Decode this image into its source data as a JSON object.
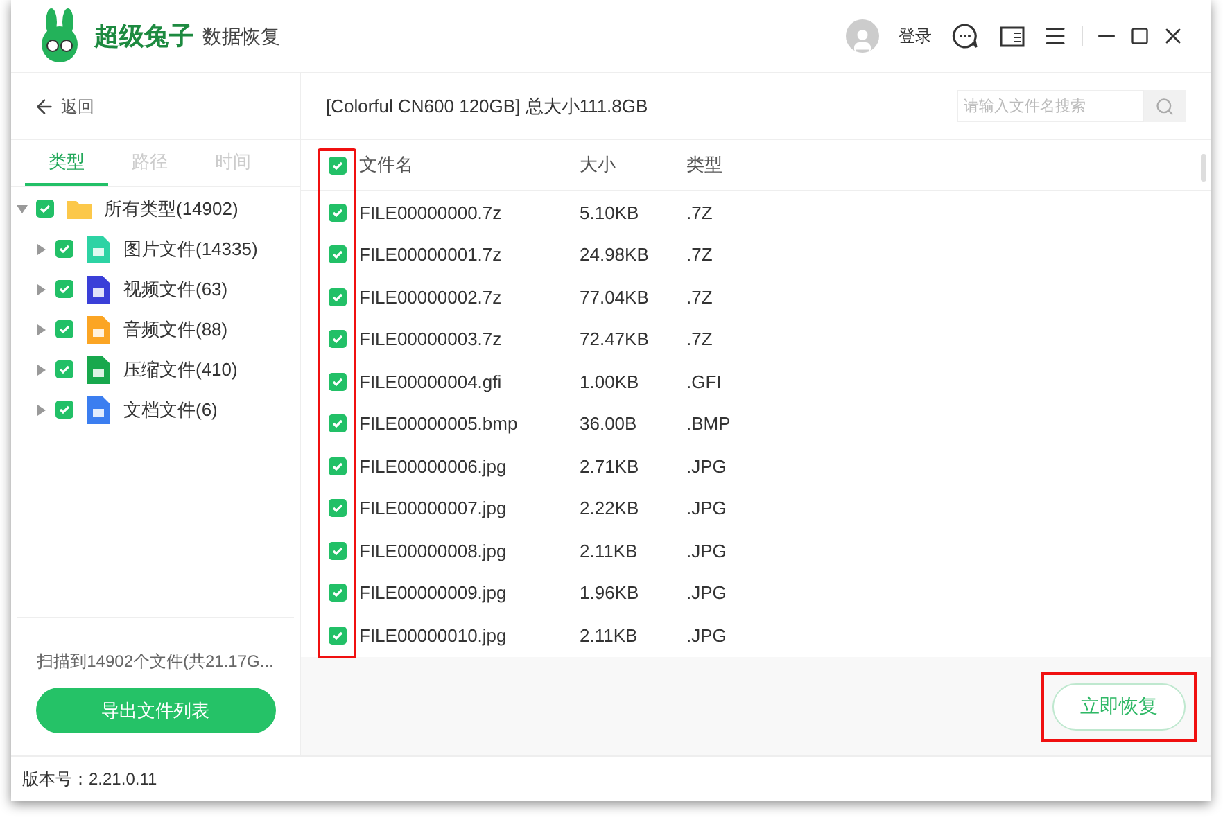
{
  "app": {
    "brand": "超级兔子",
    "product": "数据恢复"
  },
  "header": {
    "login": "登录"
  },
  "sidebar": {
    "back": "返回",
    "tabs": [
      {
        "label": "类型",
        "selected": true
      },
      {
        "label": "路径",
        "selected": false
      },
      {
        "label": "时间",
        "selected": false
      }
    ],
    "tree": [
      {
        "label": "所有类型(14902)",
        "kind": "folder",
        "checked": true,
        "expanded": true,
        "children": [
          {
            "label": "图片文件(14335)",
            "kind": "image",
            "checked": true,
            "expanded": false
          },
          {
            "label": "视频文件(63)",
            "kind": "video",
            "checked": true,
            "expanded": false
          },
          {
            "label": "音频文件(88)",
            "kind": "audio",
            "checked": true,
            "expanded": false
          },
          {
            "label": "压缩文件(410)",
            "kind": "archive",
            "checked": true,
            "expanded": false
          },
          {
            "label": "文档文件(6)",
            "kind": "document",
            "checked": true,
            "expanded": false
          }
        ]
      }
    ],
    "summary": "扫描到14902个文件(共21.17G...",
    "export_button": "导出文件列表"
  },
  "drive_title": "[Colorful CN600 120GB] 总大小111.8GB",
  "search": {
    "placeholder": "请输入文件名搜索"
  },
  "table": {
    "all_checked": true,
    "columns": [
      "文件名",
      "大小",
      "类型"
    ],
    "rows": [
      {
        "name": "FILE00000000.7z",
        "size": "5.10KB",
        "type": ".7Z",
        "checked": true
      },
      {
        "name": "FILE00000001.7z",
        "size": "24.98KB",
        "type": ".7Z",
        "checked": true
      },
      {
        "name": "FILE00000002.7z",
        "size": "77.04KB",
        "type": ".7Z",
        "checked": true
      },
      {
        "name": "FILE00000003.7z",
        "size": "72.47KB",
        "type": ".7Z",
        "checked": true
      },
      {
        "name": "FILE00000004.gfi",
        "size": "1.00KB",
        "type": ".GFI",
        "checked": true
      },
      {
        "name": "FILE00000005.bmp",
        "size": "36.00B",
        "type": ".BMP",
        "checked": true
      },
      {
        "name": "FILE00000006.jpg",
        "size": "2.71KB",
        "type": ".JPG",
        "checked": true
      },
      {
        "name": "FILE00000007.jpg",
        "size": "2.22KB",
        "type": ".JPG",
        "checked": true
      },
      {
        "name": "FILE00000008.jpg",
        "size": "2.11KB",
        "type": ".JPG",
        "checked": true
      },
      {
        "name": "FILE00000009.jpg",
        "size": "1.96KB",
        "type": ".JPG",
        "checked": true
      },
      {
        "name": "FILE00000010.jpg",
        "size": "2.11KB",
        "type": ".JPG",
        "checked": true
      }
    ]
  },
  "recover_button": "立即恢复",
  "status_bar": "版本号：2.21.0.11"
}
